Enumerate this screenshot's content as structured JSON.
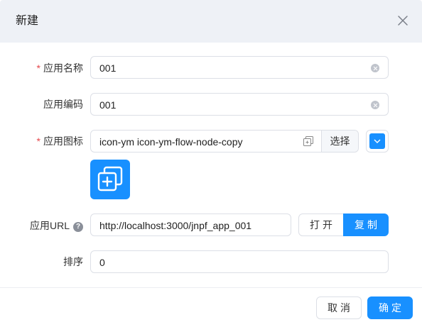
{
  "dialog": {
    "title": "新建"
  },
  "colors": {
    "primary": "#1890ff",
    "required": "#e5484d",
    "header_bg": "#eef1f6"
  },
  "form": {
    "app_name": {
      "label": "应用名称",
      "required_mark": "*",
      "value": "001"
    },
    "app_code": {
      "label": "应用编码",
      "value": "001"
    },
    "app_icon": {
      "label": "应用图标",
      "required_mark": "*",
      "value": "icon-ym icon-ym-flow-node-copy",
      "select_label": "选择",
      "icon_name": "flow-node-copy-icon",
      "color": "#1890ff"
    },
    "app_url": {
      "label": "应用URL",
      "help": "?",
      "value": "http://localhost:3000/jnpf_app_001",
      "open_label": "打开",
      "copy_label": "复制"
    },
    "sort": {
      "label": "排序",
      "value": "0"
    }
  },
  "footer": {
    "cancel_label": "取消",
    "confirm_label": "确定"
  }
}
